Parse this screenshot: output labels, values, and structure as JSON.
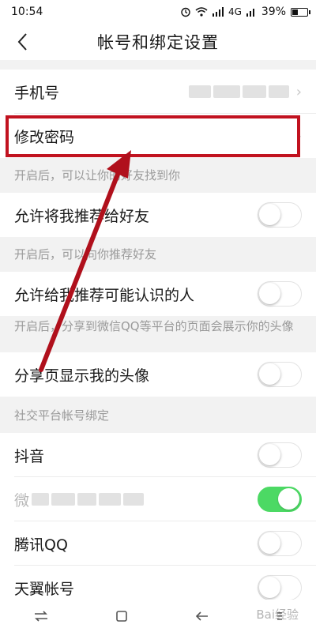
{
  "status_bar": {
    "time": "10:54",
    "network": "4G",
    "battery": "39%",
    "battery_level": 0.39
  },
  "nav": {
    "title": "帐号和绑定设置"
  },
  "rows": {
    "phone": {
      "label": "手机号"
    },
    "change_password": {
      "label": "修改密码"
    },
    "hint_friends_find": "开启后，可以让你的好友找到你",
    "recommend_me": {
      "label": "允许将我推荐给好友",
      "on": false
    },
    "hint_recommend_friends": "开启后，可以向你推荐好友",
    "recommend_known": {
      "label": "允许给我推荐可能认识的人",
      "on": false
    },
    "hint_share_avatar": "开启后，分享到微信QQ等平台的页面会展示你的头像",
    "share_avatar": {
      "label": "分享页显示我的头像",
      "on": false
    },
    "section_social": "社交平台帐号绑定",
    "douyin": {
      "label": "抖音",
      "on": false
    },
    "wechat": {
      "label": "微",
      "on": true
    },
    "qq": {
      "label": "腾讯QQ",
      "on": false
    },
    "tianyi": {
      "label": "天翼帐号",
      "on": false
    }
  },
  "watermark": "Bai经验",
  "colors": {
    "toggle_on": "#4cd964",
    "annotation_red": "#c1121f"
  },
  "icons": [
    "alarm-icon",
    "wifi-icon",
    "signal-icon",
    "battery-icon",
    "back-arrow-icon",
    "menu-icon",
    "square-icon",
    "back-nav-icon"
  ]
}
